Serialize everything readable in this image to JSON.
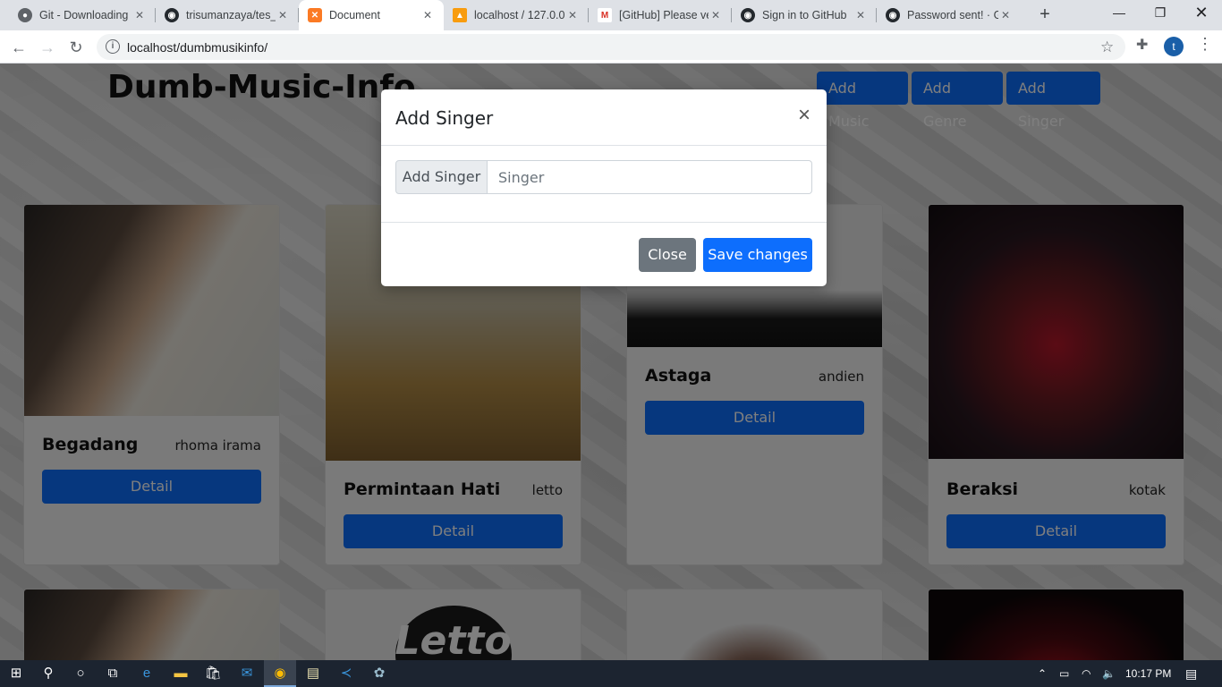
{
  "browser": {
    "tabs": [
      {
        "label": "Git - Downloading",
        "icon": "globe-icon"
      },
      {
        "label": "trisumanzaya/tes_",
        "icon": "github-icon"
      },
      {
        "label": "Document",
        "icon": "xampp-icon"
      },
      {
        "label": "localhost / 127.0.0.",
        "icon": "phpmyadmin-icon"
      },
      {
        "label": "[GitHub] Please ve",
        "icon": "gmail-icon"
      },
      {
        "label": "Sign in to GitHub",
        "icon": "github-icon"
      },
      {
        "label": "Password sent! · G",
        "icon": "github-icon"
      }
    ],
    "url": "localhost/dumbmusikinfo/",
    "profile_initial": "t"
  },
  "page": {
    "brand": "Dumb-Music-Info",
    "buttons": {
      "add_music": "Add Music",
      "add_genre": "Add Genre",
      "add_singer": "Add Singer"
    },
    "cards": [
      {
        "title": "Begadang",
        "singer": "rhoma irama",
        "detail": "Detail"
      },
      {
        "title": "Permintaan Hati",
        "singer": "letto",
        "detail": "Detail"
      },
      {
        "title": "Astaga",
        "singer": "andien",
        "detail": "Detail"
      },
      {
        "title": "Beraksi",
        "singer": "kotak",
        "detail": "Detail"
      }
    ],
    "second_row_logo": "Letto"
  },
  "modal": {
    "title": "Add Singer",
    "input_label": "Add Singer",
    "input_placeholder": "Singer",
    "input_value": "",
    "close_label": "Close",
    "save_label": "Save changes"
  },
  "taskbar": {
    "time": "10:17 PM"
  },
  "colors": {
    "primary": "#0d6efd",
    "secondary": "#6c757d",
    "taskbar": "#1c2430"
  }
}
